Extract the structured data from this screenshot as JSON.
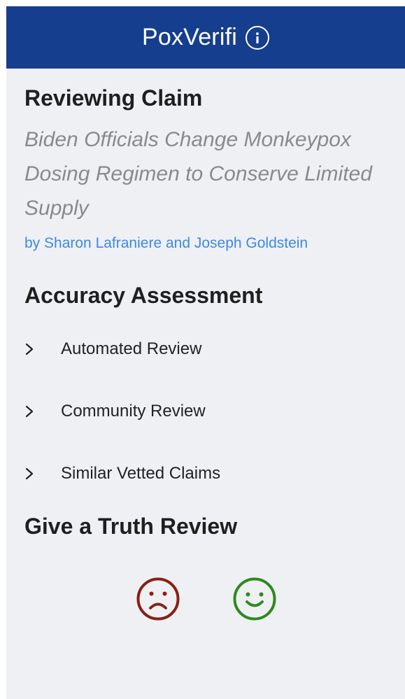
{
  "header": {
    "title": "PoxVerifi",
    "info_icon": "info-circle-icon"
  },
  "claim": {
    "section_title": "Reviewing Claim",
    "text": "Biden Officials Change Monkeypox Dosing Regimen to Conserve Limited Supply",
    "author": "by Sharon Lafraniere and Joseph Goldstein"
  },
  "assessment": {
    "section_title": "Accuracy Assessment",
    "items": [
      {
        "label": "Automated Review",
        "icon": "chevron-right-icon"
      },
      {
        "label": "Community Review",
        "icon": "chevron-right-icon"
      },
      {
        "label": "Similar Vetted Claims",
        "icon": "chevron-right-icon"
      }
    ]
  },
  "truth_review": {
    "section_title": "Give a Truth Review",
    "negative_icon": "sad-face-icon",
    "positive_icon": "happy-face-icon"
  },
  "colors": {
    "header_bg": "#163e8e",
    "page_bg": "#eff0f4",
    "author_link": "#3d89e6",
    "sad": "#8a1f14",
    "happy": "#2e8a1f"
  }
}
